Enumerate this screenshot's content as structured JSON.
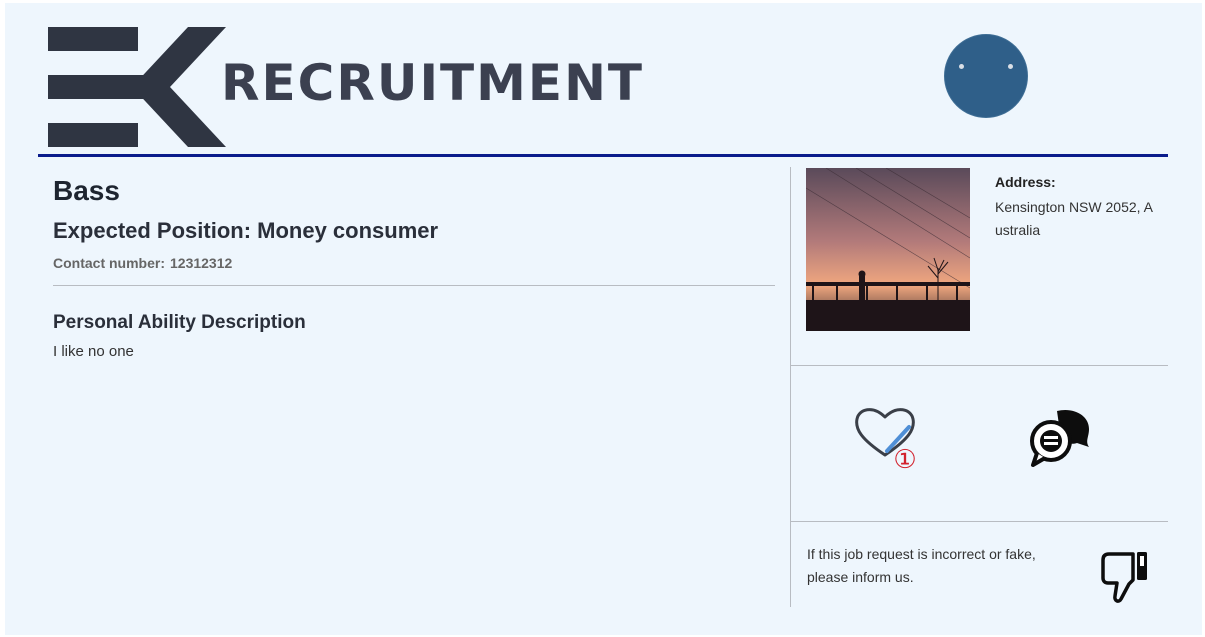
{
  "header": {
    "logo_text": "RECRUITMENT",
    "logo_mark": "EK"
  },
  "profile": {
    "name": "Bass",
    "expected_position": "Expected Position: Money consumer",
    "contact_label": "Contact number:",
    "contact_number": "12312312",
    "ability_title": "Personal Ability Description",
    "ability_text": "I like no one"
  },
  "address": {
    "label": "Address:",
    "value": "Kensington NSW 2052, Australia"
  },
  "actions": {
    "like_count": "①",
    "like_icon": "heart-icon",
    "chat_icon": "chat-bubbles-icon",
    "report_icon": "thumbs-down-icon"
  },
  "report": {
    "text": "If this job request is incorrect or fake, please inform us."
  },
  "colors": {
    "background": "#eef6fd",
    "header_rule": "#0a1c8c",
    "logo": "#2f3542",
    "avatar": "#2f5f89",
    "like_badge": "#d2222d"
  }
}
